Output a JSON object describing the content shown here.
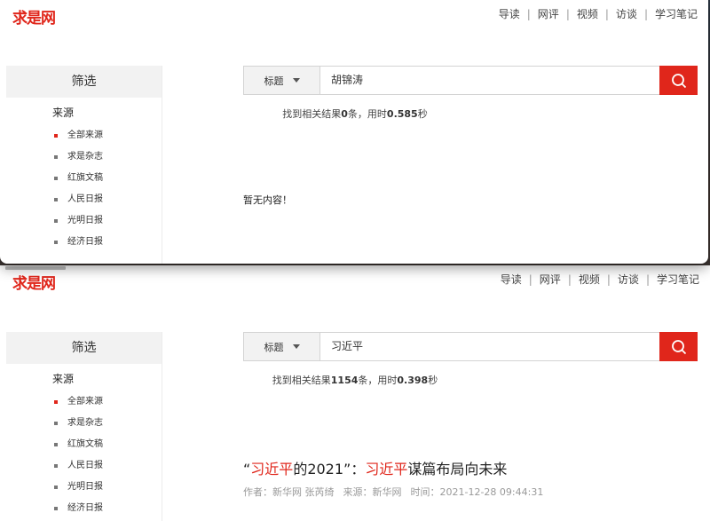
{
  "logo": "求是网",
  "nav": [
    "导读",
    "网评",
    "视频",
    "访谈",
    "学习笔记"
  ],
  "nav_sep": "|",
  "sidebar": {
    "title": "筛选",
    "source_label": "来源",
    "items": [
      "全部来源",
      "求是杂志",
      "红旗文稿",
      "人民日报",
      "光明日报",
      "经济日报"
    ]
  },
  "colors": {
    "accent": "#e0261b"
  },
  "top": {
    "search": {
      "field": "标题",
      "query": "胡锦涛"
    },
    "result": {
      "prefix": "找到相关结果",
      "count": "0",
      "mid": "条，用时",
      "time": "0.585",
      "suffix": "秒"
    },
    "empty_text": "暂无内容！"
  },
  "bottom": {
    "search": {
      "field": "标题",
      "query": "习近平"
    },
    "result": {
      "prefix": "找到相关结果",
      "count": "1154",
      "mid": "条，用时",
      "time": "0.398",
      "suffix": "秒"
    },
    "article": {
      "t1": "“",
      "t2": "习近平",
      "t3": "的2021”：",
      "t4": "习近平",
      "t5": "谋篇布局向未来",
      "author": "作者：新华网 张芮绮",
      "source": "来源：新华网",
      "time": "时间：2021-12-28 09:44:31"
    }
  }
}
